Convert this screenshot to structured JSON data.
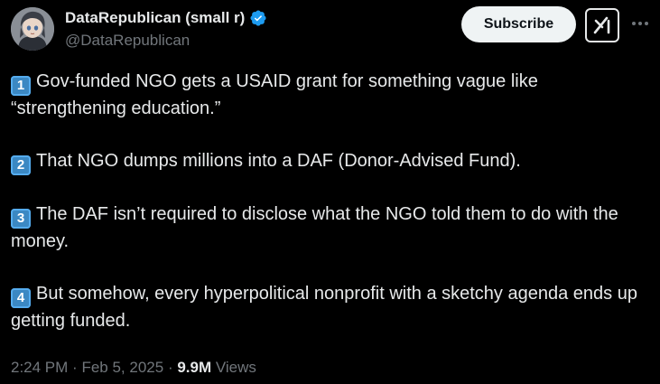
{
  "author": {
    "display_name": "DataRepublican (small r)",
    "handle": "@DataRepublican",
    "verified": true,
    "verified_color": "#1d9bf0",
    "avatar_icon": "anime-avatar"
  },
  "header": {
    "subscribe_label": "Subscribe",
    "grok_icon": "grok-icon",
    "more_icon": "more-horizontal-icon"
  },
  "post": {
    "paragraphs": [
      {
        "keycap": "1",
        "text": "Gov-funded NGO gets a USAID grant for something vague like “strengthening education.”"
      },
      {
        "keycap": "2",
        "text": "That NGO dumps millions into a DAF (Donor-Advised Fund)."
      },
      {
        "keycap": "3",
        "text": "The DAF isn’t required to disclose what the NGO told them to do with the money."
      },
      {
        "keycap": "4",
        "text": "But somehow, every hyperpolitical nonprofit with a sketchy agenda ends up getting funded."
      }
    ]
  },
  "meta": {
    "time": "2:24 PM",
    "separator": "·",
    "date": "Feb 5, 2025",
    "views_count": "9.9M",
    "views_label": "Views"
  }
}
